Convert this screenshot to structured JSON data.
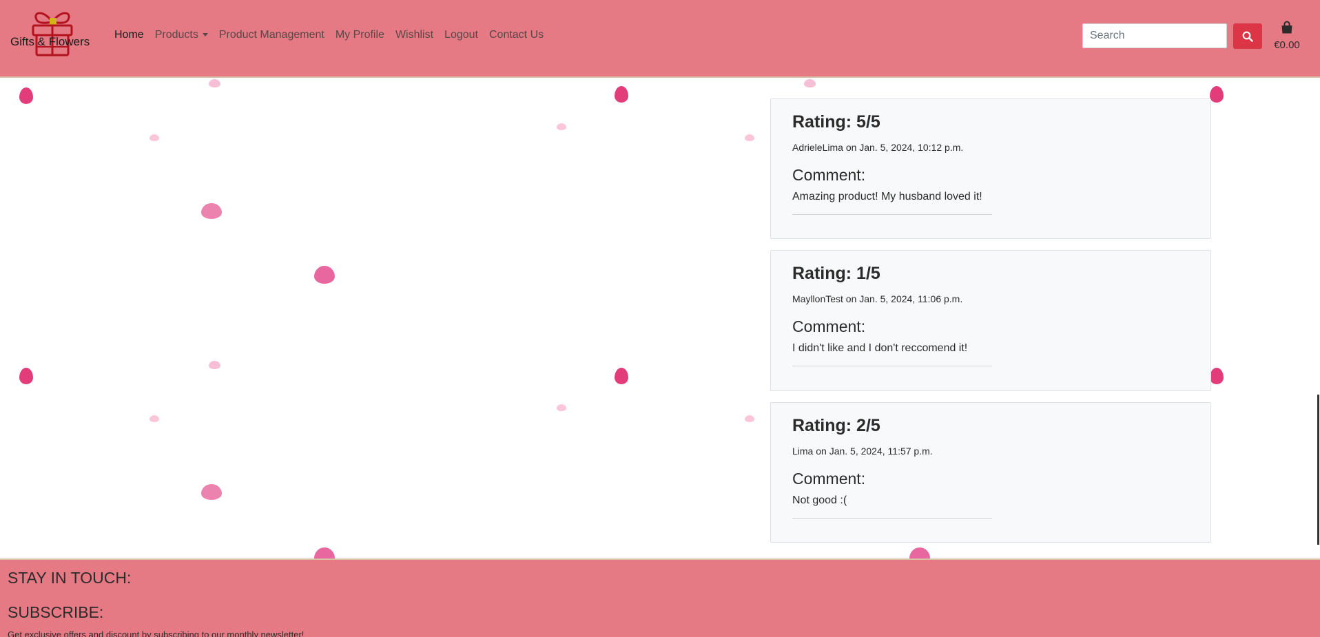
{
  "brand": {
    "name": "Gifts & Flowers"
  },
  "nav": {
    "items": [
      {
        "label": "Home"
      },
      {
        "label": "Products"
      },
      {
        "label": "Product Management"
      },
      {
        "label": "My Profile"
      },
      {
        "label": "Wishlist"
      },
      {
        "label": "Logout"
      },
      {
        "label": "Contact Us"
      }
    ]
  },
  "search": {
    "placeholder": "Search",
    "icon": "search-icon"
  },
  "cart": {
    "amount": "€0.00",
    "icon": "shopping-bag-icon"
  },
  "reviews": [
    {
      "rating": "Rating: 5/5",
      "meta": "AdrieleLima on Jan. 5, 2024, 10:12 p.m.",
      "comment_label": "Comment:",
      "comment": "Amazing product! My husband loved it!"
    },
    {
      "rating": "Rating: 1/5",
      "meta": "MayllonTest on Jan. 5, 2024, 11:06 p.m.",
      "comment_label": "Comment:",
      "comment": "I didn't like and I don't reccomend it!"
    },
    {
      "rating": "Rating: 2/5",
      "meta": "Lima on Jan. 5, 2024, 11:57 p.m.",
      "comment_label": "Comment:",
      "comment": "Not good :("
    }
  ],
  "footer": {
    "stay_in_touch": "STAY IN TOUCH:",
    "subscribe": "SUBSCRIBE:",
    "newsletter_text": "Get exclusive offers and discount by subscribing to our monthly newsletter!"
  },
  "colors": {
    "navbar_bg": "#e57a85",
    "search_button": "#dc3545",
    "card_bg": "#f8f9fa"
  }
}
